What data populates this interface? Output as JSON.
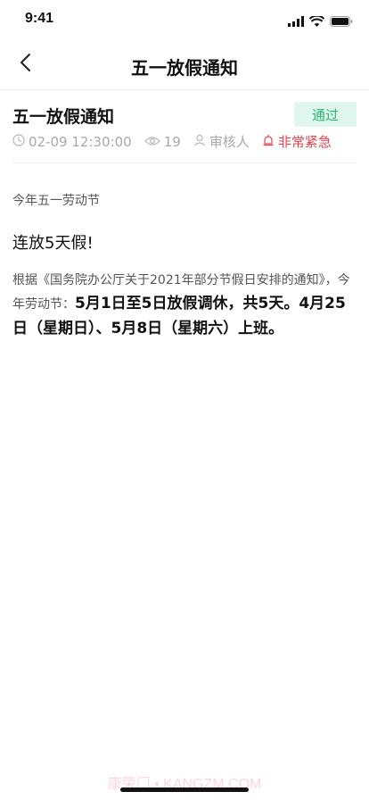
{
  "status_bar": {
    "time": "9:41"
  },
  "nav": {
    "title": "五一放假通知"
  },
  "header": {
    "title": "五一放假通知",
    "status_badge": "通过",
    "meta": {
      "datetime": "02-09 12:30:00",
      "views": "19",
      "reviewer": "审核人",
      "urgency": "非常紧急"
    }
  },
  "content": {
    "line1": "今年五一劳动节",
    "line2": "连放5天假!",
    "para_intro": "根据《国务院办公厅关于2021年部分节假日安排的通知》，今年劳动节：",
    "para_bold": "5月1日至5日放假调休，共5天。4月25日（星期日）、5月8日（星期六）上班。"
  },
  "watermark": "康荣门 • KANGZM.COM",
  "colors": {
    "approved_bg": "#dff7ee",
    "approved_text": "#2bb673",
    "urgent": "#e5454f"
  }
}
